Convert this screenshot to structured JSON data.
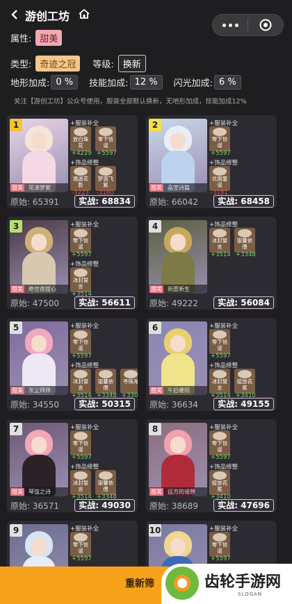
{
  "header": {
    "title": "游创工坊"
  },
  "filters": {
    "attribute_label": "属性:",
    "attribute_value": "甜美",
    "type_label": "类型:",
    "type_value": "奇迹之冠",
    "level_label": "等级:",
    "level_value": "换新",
    "terrain_label": "地形加成:",
    "terrain_value": "0 %",
    "skill_label": "技能加成:",
    "skill_value": "12 %",
    "flash_label": "闪光加成:",
    "flash_value": "6 %",
    "note": "关注【游创工坊】公众号使用，服装全部默认换新，无地形加成，技能加成12%"
  },
  "labels": {
    "clothing_supplement": "+服装补全",
    "accessory_adjust": "+饰品修整",
    "original_prefix": "原始:",
    "actual_prefix": "实战:",
    "tag": "甜美"
  },
  "cards": [
    {
      "rank": "1",
      "name": "花漾梦萦",
      "original": "65391",
      "actual": "68834",
      "clothing": [
        {
          "name": "放白珠花",
          "delta": "+4229"
        },
        {
          "name": "零下信谣",
          "delta": "+5597"
        }
      ],
      "accessories": [
        {
          "name": "逸迷花影",
          "delta": "-3223"
        },
        {
          "name": "梦惑飞絮",
          "delta": "-3160"
        }
      ]
    },
    {
      "rank": "2",
      "name": "晶莹诗篇",
      "original": "66042",
      "actual": "68458",
      "clothing": [
        {
          "name": "零下信谣",
          "delta": "+5597"
        }
      ],
      "accessories": [
        {
          "name": "北国童谣",
          "delta": "-3181"
        }
      ]
    },
    {
      "rank": "3",
      "name": "绝世夜甜心",
      "original": "47500",
      "actual": "56611",
      "clothing": [
        {
          "name": "零下信谣",
          "delta": "+5597"
        }
      ],
      "accessories": [
        {
          "name": "冰封誓言",
          "delta": "+3514"
        }
      ]
    },
    {
      "rank": "4",
      "name": "祈愿新生",
      "original": "49222",
      "actual": "56084",
      "clothing": [],
      "accessories": [
        {
          "name": "冰封誓言",
          "delta": "+3514"
        },
        {
          "name": "银蔓依偎",
          "delta": "+3348"
        }
      ]
    },
    {
      "rank": "5",
      "name": "灰尘拜拜",
      "original": "34550",
      "actual": "50315",
      "clothing": [
        {
          "name": "零下信谣",
          "delta": "+5597"
        }
      ],
      "accessories": [
        {
          "name": "冰封誓言",
          "delta": "+3514"
        },
        {
          "name": "银蔓依偎",
          "delta": "+3348"
        },
        {
          "name": "寻珠海",
          "delta": "+330"
        }
      ]
    },
    {
      "rank": "6",
      "name": "午后暖阳",
      "original": "36634",
      "actual": "49155",
      "clothing": [
        {
          "name": "零下信谣",
          "delta": "+5597"
        }
      ],
      "accessories": [
        {
          "name": "冰封誓言",
          "delta": "+3514"
        },
        {
          "name": "绽放花冕",
          "delta": "+3410"
        }
      ]
    },
    {
      "rank": "7",
      "name": "琴弦之诗",
      "original": "36571",
      "actual": "49030",
      "clothing": [
        {
          "name": "零下信谣",
          "delta": "+5597"
        }
      ],
      "accessories": [
        {
          "name": "冰封誓言",
          "delta": "+3514"
        },
        {
          "name": "银蔓依偎",
          "delta": "+3348"
        }
      ]
    },
    {
      "rank": "8",
      "name": "远方的谣想",
      "original": "38689",
      "actual": "47696",
      "clothing": [
        {
          "name": "零下信谣",
          "delta": "+5597"
        }
      ],
      "accessories": [
        {
          "name": "绽放花冕",
          "delta": "+3410"
        }
      ]
    },
    {
      "rank": "9",
      "name": "",
      "original": "",
      "actual": "",
      "clothing": [
        {
          "name": "零下信谣",
          "delta": "+5597"
        }
      ],
      "accessories": []
    },
    {
      "rank": "10",
      "name": "",
      "original": "",
      "actual": "",
      "clothing": [
        {
          "name": "零下信谣",
          "delta": "+5597"
        }
      ],
      "accessories": []
    }
  ],
  "bottom": {
    "button": "重新筛"
  },
  "watermark": {
    "brand": "齿轮手游网",
    "slogan": "SLOGAN"
  },
  "colors": {
    "accent": "#f7a21b",
    "rank_1": "#f5c233",
    "rank_2": "#f5e047",
    "rank_3": "#b8e070",
    "rank_default": "#e0e0e0"
  }
}
